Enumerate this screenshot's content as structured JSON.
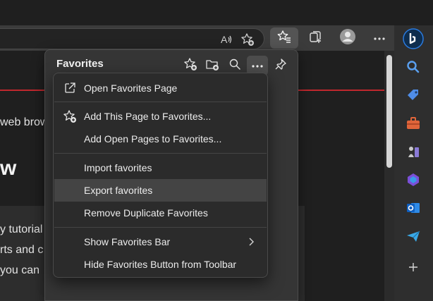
{
  "browser": {
    "icons": {
      "read_aloud": "read-aloud-icon",
      "add_favorite": "add-favorite-icon",
      "favorites": "favorites-icon",
      "collections": "collections-icon",
      "profile": "profile-icon",
      "more": "more-icon",
      "bing": "bing-icon"
    },
    "sidebar_icons": [
      "search-icon",
      "shopping-tag-icon",
      "tools-icon",
      "games-icon",
      "copilot-icon",
      "outlook-icon",
      "telegram-icon",
      "add-icon"
    ]
  },
  "page": {
    "line1": "web brow",
    "big_text": "w",
    "line2": "y tutorial",
    "line3": "rts and c",
    "line4": " you can",
    "accent_color": "#c0272d"
  },
  "favorites": {
    "title": "Favorites",
    "header_icons": [
      "add-favorite-icon",
      "add-folder-icon",
      "search-icon",
      "more-icon",
      "pin-icon"
    ]
  },
  "menu": {
    "items": [
      {
        "label": "Open Favorites Page",
        "icon": "open-external-icon"
      },
      {
        "label": "Add This Page to Favorites...",
        "icon": "add-favorite-icon"
      },
      {
        "label": "Add Open Pages to Favorites..."
      },
      {
        "label": "Import favorites"
      },
      {
        "label": "Export favorites",
        "highlighted": true
      },
      {
        "label": "Remove Duplicate Favorites"
      },
      {
        "label": "Show Favorites Bar",
        "submenu": true
      },
      {
        "label": "Hide Favorites Button from Toolbar"
      }
    ]
  }
}
